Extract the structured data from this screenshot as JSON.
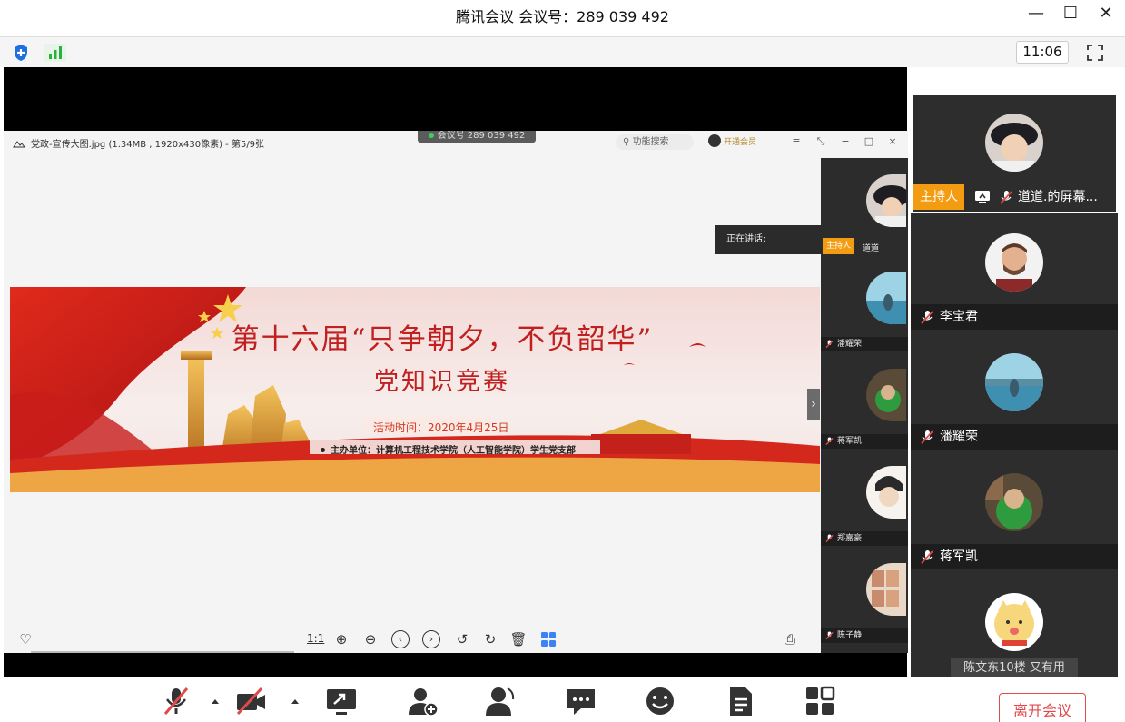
{
  "window": {
    "title": "腾讯会议 会议号：289 039 492",
    "minimize_label": "—",
    "maximize_label": "☐",
    "close_label": "✕"
  },
  "status": {
    "time": "11:06",
    "icons": [
      "shield-icon",
      "signal-icon",
      "fullscreen-icon"
    ],
    "colors": {
      "shield": "#1e6fe0",
      "signal": "#26b33d"
    }
  },
  "shared_screen": {
    "viewer_title": "党政-宣传大图.jpg (1.34MB , 1920x430像素) - 第5/9张",
    "meeting_float": "会议号 289 039 492",
    "search_placeholder": "功能搜索",
    "vip_label": "开通会员",
    "speaking_label": "正在讲话:",
    "banner": {
      "title": "第十六届“只争朝夕，不负韶华”",
      "subtitle": "党知识竞赛",
      "date": "活动时间：2020年4月25日",
      "host": "主办单位：计算机工程技术学院（人工智能学院）学生党支部"
    },
    "toolbar": {
      "ratio_label": "1:1"
    },
    "strip": [
      {
        "name": "道道",
        "host_label": "主持人"
      },
      {
        "name": "潘耀荣"
      },
      {
        "name": "蒋军凯"
      },
      {
        "name": "郑嘉豪"
      },
      {
        "name": "陈子静"
      }
    ]
  },
  "gallery": {
    "host_tile": {
      "host_label": "主持人",
      "name": "道道.的屏幕..."
    },
    "tiles": [
      {
        "name": "李宝君"
      },
      {
        "name": "潘耀荣"
      },
      {
        "name": "蒋军凯"
      },
      {
        "name": ""
      }
    ],
    "more_label": "陈文东10楼 又有用"
  },
  "toolbar": {
    "icons": [
      "mic-muted-icon",
      "camera-off-icon",
      "share-screen-icon",
      "invite-icon",
      "members-icon",
      "chat-icon",
      "reaction-icon",
      "document-icon",
      "apps-icon"
    ],
    "leave_label": "离开会议",
    "colors": {
      "leave": "#e04a4a",
      "muted": "#e04a4a"
    }
  }
}
